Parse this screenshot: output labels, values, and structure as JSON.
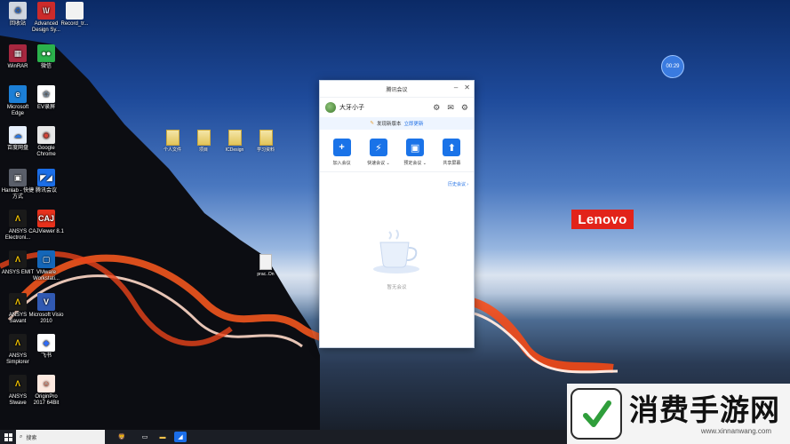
{
  "desktop": {
    "brand": "Lenovo",
    "clock_bubble": "00:29",
    "icons": [
      {
        "label": "回收站",
        "glyph": "♻",
        "bg": "#d0d6e0",
        "fg": "#2a6bd1"
      },
      {
        "label": "Advanced Design Sy...",
        "glyph": "\\\\/",
        "bg": "#cc2b2b",
        "fg": "#fff"
      },
      {
        "label": "Record_tr...",
        "glyph": "",
        "bg": "#f2f2f2",
        "fg": "#333"
      },
      {
        "label": "WinRAR",
        "glyph": "▦",
        "bg": "#a6273f",
        "fg": "#fff"
      },
      {
        "label": "微信",
        "glyph": "●●",
        "bg": "#2bb24c",
        "fg": "#fff"
      },
      {
        "label": "Microsoft Edge",
        "glyph": "e",
        "bg": "#1c7fd6",
        "fg": "#fff"
      },
      {
        "label": "EV录屏",
        "glyph": "✿",
        "bg": "#ffffff",
        "fg": "#7a8c9e"
      },
      {
        "label": "百度网盘",
        "glyph": "☁",
        "bg": "#e8f0fc",
        "fg": "#2b78e4"
      },
      {
        "label": "Google Chrome",
        "glyph": "◉",
        "bg": "#e8e8e8",
        "fg": "#db4437"
      },
      {
        "label": "Hanlab - 快捷方式",
        "glyph": "▣",
        "bg": "#5a5f6a",
        "fg": "#fff"
      },
      {
        "label": "腾讯会议",
        "glyph": "◤◢",
        "bg": "#1b6ee8",
        "fg": "#fff"
      },
      {
        "label": "ANSYS Electroni...",
        "glyph": "Λ",
        "bg": "#1a1a1a",
        "fg": "#f3c300"
      },
      {
        "label": "CAJViewer 8.1",
        "glyph": "CAJ",
        "bg": "#e6311c",
        "fg": "#fff"
      },
      {
        "label": "ANSYS EMIT",
        "glyph": "Λ",
        "bg": "#1a1a1a",
        "fg": "#f3c300"
      },
      {
        "label": "VMware Workstati...",
        "glyph": "▢",
        "bg": "#1466b8",
        "fg": "#fff"
      },
      {
        "label": "ANSYS Savant",
        "glyph": "Λ",
        "bg": "#1a1a1a",
        "fg": "#f3c300"
      },
      {
        "label": "Microsoft Visio 2010",
        "glyph": "V",
        "bg": "#3159b2",
        "fg": "#fff"
      },
      {
        "label": "ANSYS Simplorer",
        "glyph": "Λ",
        "bg": "#1a1a1a",
        "fg": "#f3c300"
      },
      {
        "label": "飞书",
        "glyph": "◆",
        "bg": "#ffffff",
        "fg": "#2f6bf5"
      },
      {
        "label": "ANSYS Slwave",
        "glyph": "Λ",
        "bg": "#1a1a1a",
        "fg": "#f3c300"
      },
      {
        "label": "OriginPro 2017 64Bit",
        "glyph": "☺",
        "bg": "#fde9e0",
        "fg": "#d64a2a"
      }
    ],
    "folders": [
      "个人文件",
      "项目",
      "ICDesign",
      "学习资料"
    ],
    "stray_doc": "prac..On"
  },
  "meeting": {
    "title": "腾讯会议",
    "user": "大牙小子",
    "notice_text": "发现新版本",
    "notice_link": "立即更新",
    "actions": [
      {
        "label": "加入会议",
        "glyph": "+"
      },
      {
        "label": "快速会议 ⌄",
        "glyph": "⚡"
      },
      {
        "label": "预定会议 ⌄",
        "glyph": "▣"
      },
      {
        "label": "共享屏幕",
        "glyph": "⬆"
      }
    ],
    "history_link": "历史会议 ›",
    "empty_text": "暂无会议"
  },
  "taskbar": {
    "search_placeholder": "搜索"
  },
  "watermark": {
    "title": "消费手游网",
    "url": "www.xinnanwang.com"
  },
  "colors": {
    "accent": "#1a73e8",
    "lenovo_red": "#e2231a"
  }
}
